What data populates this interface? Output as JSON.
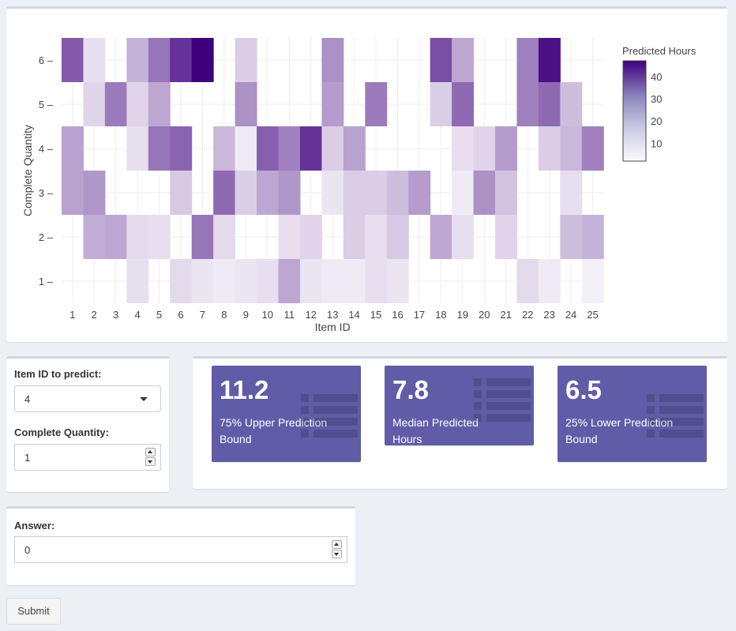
{
  "chart_data": {
    "type": "heatmap",
    "xlabel": "Item ID",
    "ylabel": "Complete Quantity",
    "x": [
      1,
      2,
      3,
      4,
      5,
      6,
      7,
      8,
      9,
      10,
      11,
      12,
      13,
      14,
      15,
      16,
      17,
      18,
      19,
      20,
      21,
      22,
      23,
      24,
      25
    ],
    "y": [
      1,
      2,
      3,
      4,
      5,
      6
    ],
    "values": [
      [
        null,
        null,
        null,
        7,
        null,
        8,
        6,
        5,
        6,
        7,
        17,
        6,
        5,
        5,
        7,
        6,
        null,
        null,
        null,
        null,
        null,
        8,
        5,
        null,
        4
      ],
      [
        null,
        16,
        17,
        8,
        7,
        null,
        26,
        8,
        null,
        null,
        7,
        9,
        null,
        10,
        7,
        11,
        null,
        17,
        7,
        null,
        9,
        null,
        null,
        13,
        15
      ],
      [
        18,
        20,
        null,
        null,
        null,
        11,
        null,
        28,
        10,
        17,
        20,
        null,
        6,
        10,
        10,
        13,
        19,
        null,
        5,
        21,
        12,
        null,
        null,
        7,
        null
      ],
      [
        18,
        null,
        null,
        7,
        26,
        29,
        null,
        14,
        5,
        30,
        24,
        38,
        10,
        18,
        null,
        null,
        null,
        null,
        7,
        9,
        19,
        null,
        10,
        14,
        24
      ],
      [
        null,
        9,
        25,
        9,
        17,
        null,
        null,
        null,
        21,
        null,
        null,
        null,
        19,
        null,
        25,
        null,
        null,
        10,
        28,
        null,
        null,
        24,
        28,
        13,
        null
      ],
      [
        31,
        7,
        null,
        15,
        26,
        38,
        47,
        null,
        10,
        null,
        null,
        null,
        21,
        null,
        null,
        null,
        null,
        33,
        17,
        null,
        null,
        24,
        44,
        null,
        null
      ]
    ],
    "colorbar": {
      "title": "Predicted Hours",
      "ticks": [
        10,
        20,
        30,
        40
      ],
      "range": [
        2,
        47
      ]
    },
    "colors": {
      "low": "#fcfbfd",
      "high": "#3f007d"
    },
    "grid": true
  },
  "inputs": {
    "item_label": "Item ID to predict:",
    "item_value": "4",
    "qty_label": "Complete Quantity:",
    "qty_value": "1"
  },
  "value_boxes": [
    {
      "value": "11.2",
      "subtitle": "75% Upper Prediction Bound",
      "icon": "list-icon"
    },
    {
      "value": "7.8",
      "subtitle": "Median Predicted Hours",
      "icon": "list-icon"
    },
    {
      "value": "6.5",
      "subtitle": "25% Lower Prediction Bound",
      "icon": "list-icon"
    }
  ],
  "answer": {
    "label": "Answer:",
    "value": "0"
  },
  "submit_label": "Submit",
  "colors": {
    "box_bg": "#605ca8",
    "page_bg": "#ecf0f5"
  }
}
